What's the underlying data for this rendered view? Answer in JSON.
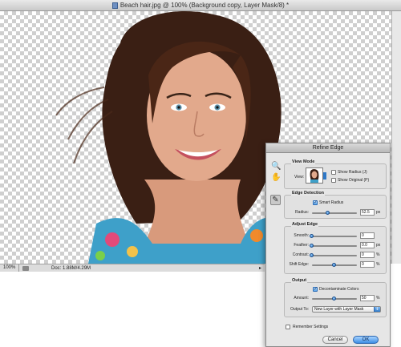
{
  "document": {
    "title": "Beach hair.jpg @ 100% (Background copy, Layer Mask/8) *",
    "zoom": "100%",
    "doc_size": "Doc: 1.88M/4.29M"
  },
  "dialog": {
    "title": "Refine Edge",
    "view_mode": {
      "title": "View Mode",
      "view_label": "View:",
      "show_radius": {
        "label": "Show Radius (J)",
        "checked": false
      },
      "show_original": {
        "label": "Show Original (P)",
        "checked": false
      }
    },
    "edge_detection": {
      "title": "Edge Detection",
      "smart_radius": {
        "label": "Smart Radius",
        "checked": true
      },
      "radius": {
        "label": "Radius:",
        "value": "52.5",
        "unit": "px",
        "level": 0.35
      }
    },
    "adjust_edge": {
      "title": "Adjust Edge",
      "smooth": {
        "label": "Smooth:",
        "value": "0",
        "unit": "",
        "level": 0.0
      },
      "feather": {
        "label": "Feather:",
        "value": "0.0",
        "unit": "px",
        "level": 0.0
      },
      "contrast": {
        "label": "Contrast:",
        "value": "0",
        "unit": "%",
        "level": 0.0
      },
      "shift_edge": {
        "label": "Shift Edge:",
        "value": "0",
        "unit": "%",
        "level": 0.5
      }
    },
    "output": {
      "title": "Output",
      "decontaminate": {
        "label": "Decontaminate Colors",
        "checked": true
      },
      "amount": {
        "label": "Amount:",
        "value": "50",
        "unit": "%",
        "level": 0.5
      },
      "output_to": {
        "label": "Output To:",
        "selected": "New Layer with Layer Mask"
      }
    },
    "remember": {
      "label": "Remember Settings",
      "checked": false
    },
    "buttons": {
      "cancel": "Cancel",
      "ok": "OK"
    }
  },
  "colors": {
    "accent": "#2e78c7",
    "hair": "#3a1f14",
    "skin": "#e2a98c"
  }
}
